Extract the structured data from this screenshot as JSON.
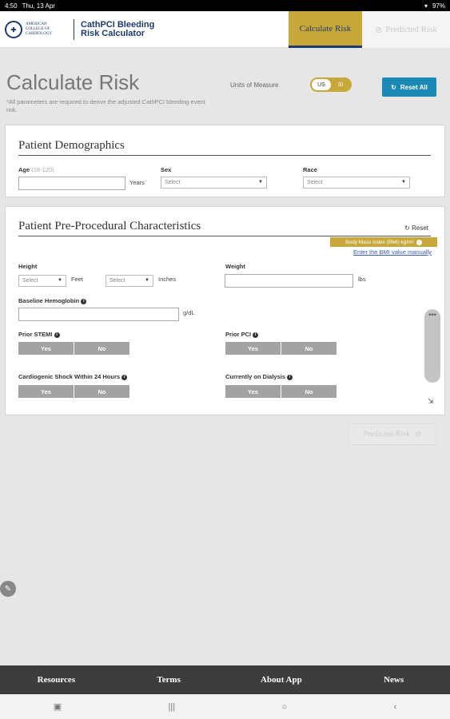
{
  "status": {
    "time": "4:50",
    "date": "Thu, 13 Apr",
    "battery": "97%"
  },
  "header": {
    "org_line1": "American",
    "org_line2": "College of",
    "org_line3": "Cardiology",
    "app_title_line1": "CathPCI Bleeding",
    "app_title_line2": "Risk Calculator",
    "tab_calculate": "Calculate Risk",
    "tab_predicted": "Predicted Risk"
  },
  "page": {
    "title": "Calculate Risk",
    "note": "*All parameters are required to derive the adjusted CathPCI bleeding event risk.",
    "units_label": "Units of Measure",
    "units_us": "US",
    "units_si": "SI",
    "reset_all": "Reset All"
  },
  "demographics": {
    "title": "Patient Demographics",
    "age_label": "Age",
    "age_hint": "(18-120)",
    "age_unit": "Years",
    "sex_label": "Sex",
    "sex_value": "Select",
    "race_label": "Race",
    "race_value": "Select"
  },
  "preproc": {
    "title": "Patient Pre-Procedural Characteristics",
    "reset": "Reset",
    "bmi_bar": "Body Mass Index (BMI) kg/m²",
    "bmi_link": "Enter the BMI value manually",
    "height_label": "Height",
    "height_feet_value": "Select",
    "height_feet_unit": "Feet",
    "height_inches_value": "Select",
    "height_inches_unit": "Inches",
    "weight_label": "Weight",
    "weight_unit": "lbs",
    "hgb_label": "Baseline Hemoglobin",
    "hgb_unit": "g/dL",
    "stemi_label": "Prior STEMI",
    "pci_label": "Prior PCI",
    "shock_label": "Cardiogenic Shock Within 24 Hours",
    "dialysis_label": "Currently on Dialysis",
    "yes": "Yes",
    "no": "No"
  },
  "predicted_button": "Predicted Risk",
  "footer": {
    "resources": "Resources",
    "terms": "Terms",
    "about": "About App",
    "news": "News"
  }
}
